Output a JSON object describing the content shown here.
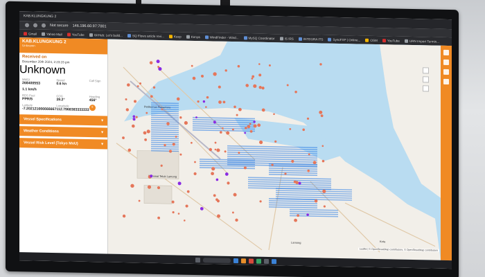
{
  "browser": {
    "url": "146.196.60.97:7001",
    "address_prefix": "Not secure",
    "bookmarks": [
      "Gmail",
      "Yahoo Mail",
      "YouTube",
      "GitHub: Let's build...",
      "SQ Flows article revi...",
      "Keep",
      "Kenya",
      "WindFinder - Wind...",
      "MySQ Coordinator",
      "IS IRS",
      "INTEGRA ITS",
      "SyncFXP | Online...",
      "OSM",
      "YouTube",
      "URN Import Termin..."
    ]
  },
  "panel": {
    "vessel_name": "KAB.KLUNGKUNG 2",
    "vessel_sub": "Unknown",
    "close_label": "Unknown",
    "received_label": "Received on",
    "received_ts": "December 20th 2024, 2:23:15 pm",
    "status": "Unknown",
    "fields": [
      {
        "k": "MMSI",
        "v": "268400553"
      },
      {
        "k": "Speed",
        "v": "0.6 kn"
      },
      {
        "k": "Call Sign",
        "v": ""
      },
      {
        "k": "",
        "v": "1.1 km/h"
      },
      {
        "k": "",
        "v": ""
      },
      {
        "k": "",
        "v": ""
      },
      {
        "k": "RDS Pool",
        "v": "PPR/5"
      },
      {
        "k": "COG",
        "v": "39.2°"
      },
      {
        "k": "Heading",
        "v": "456°"
      },
      {
        "k": "Latitude",
        "v": "-7.202121666666667"
      },
      {
        "k": "Longitude",
        "v": "112.7968383333333"
      },
      {
        "k": "",
        "v": "+"
      }
    ],
    "sections": [
      {
        "label": "Vessel Specifications"
      },
      {
        "label": "Weather Conditions"
      },
      {
        "label": "Vessel Risk Level (Tokyo MoU)"
      }
    ]
  },
  "map": {
    "place_labels": [
      "Petikemas Nusantara",
      "Terminal Teluk Lamong",
      "Lamong",
      "Kota"
    ],
    "attribution": "Leaflet | © OpenStreetMap contributors, © OpenStreetMap contributors"
  },
  "colors": {
    "accent": "#f08a24",
    "sea": "#b9dcf1",
    "land": "#f2efe9",
    "vessel": "#e5765a",
    "vessel_alt": "#8a2be2",
    "anchorage": "#2f7fe6"
  }
}
